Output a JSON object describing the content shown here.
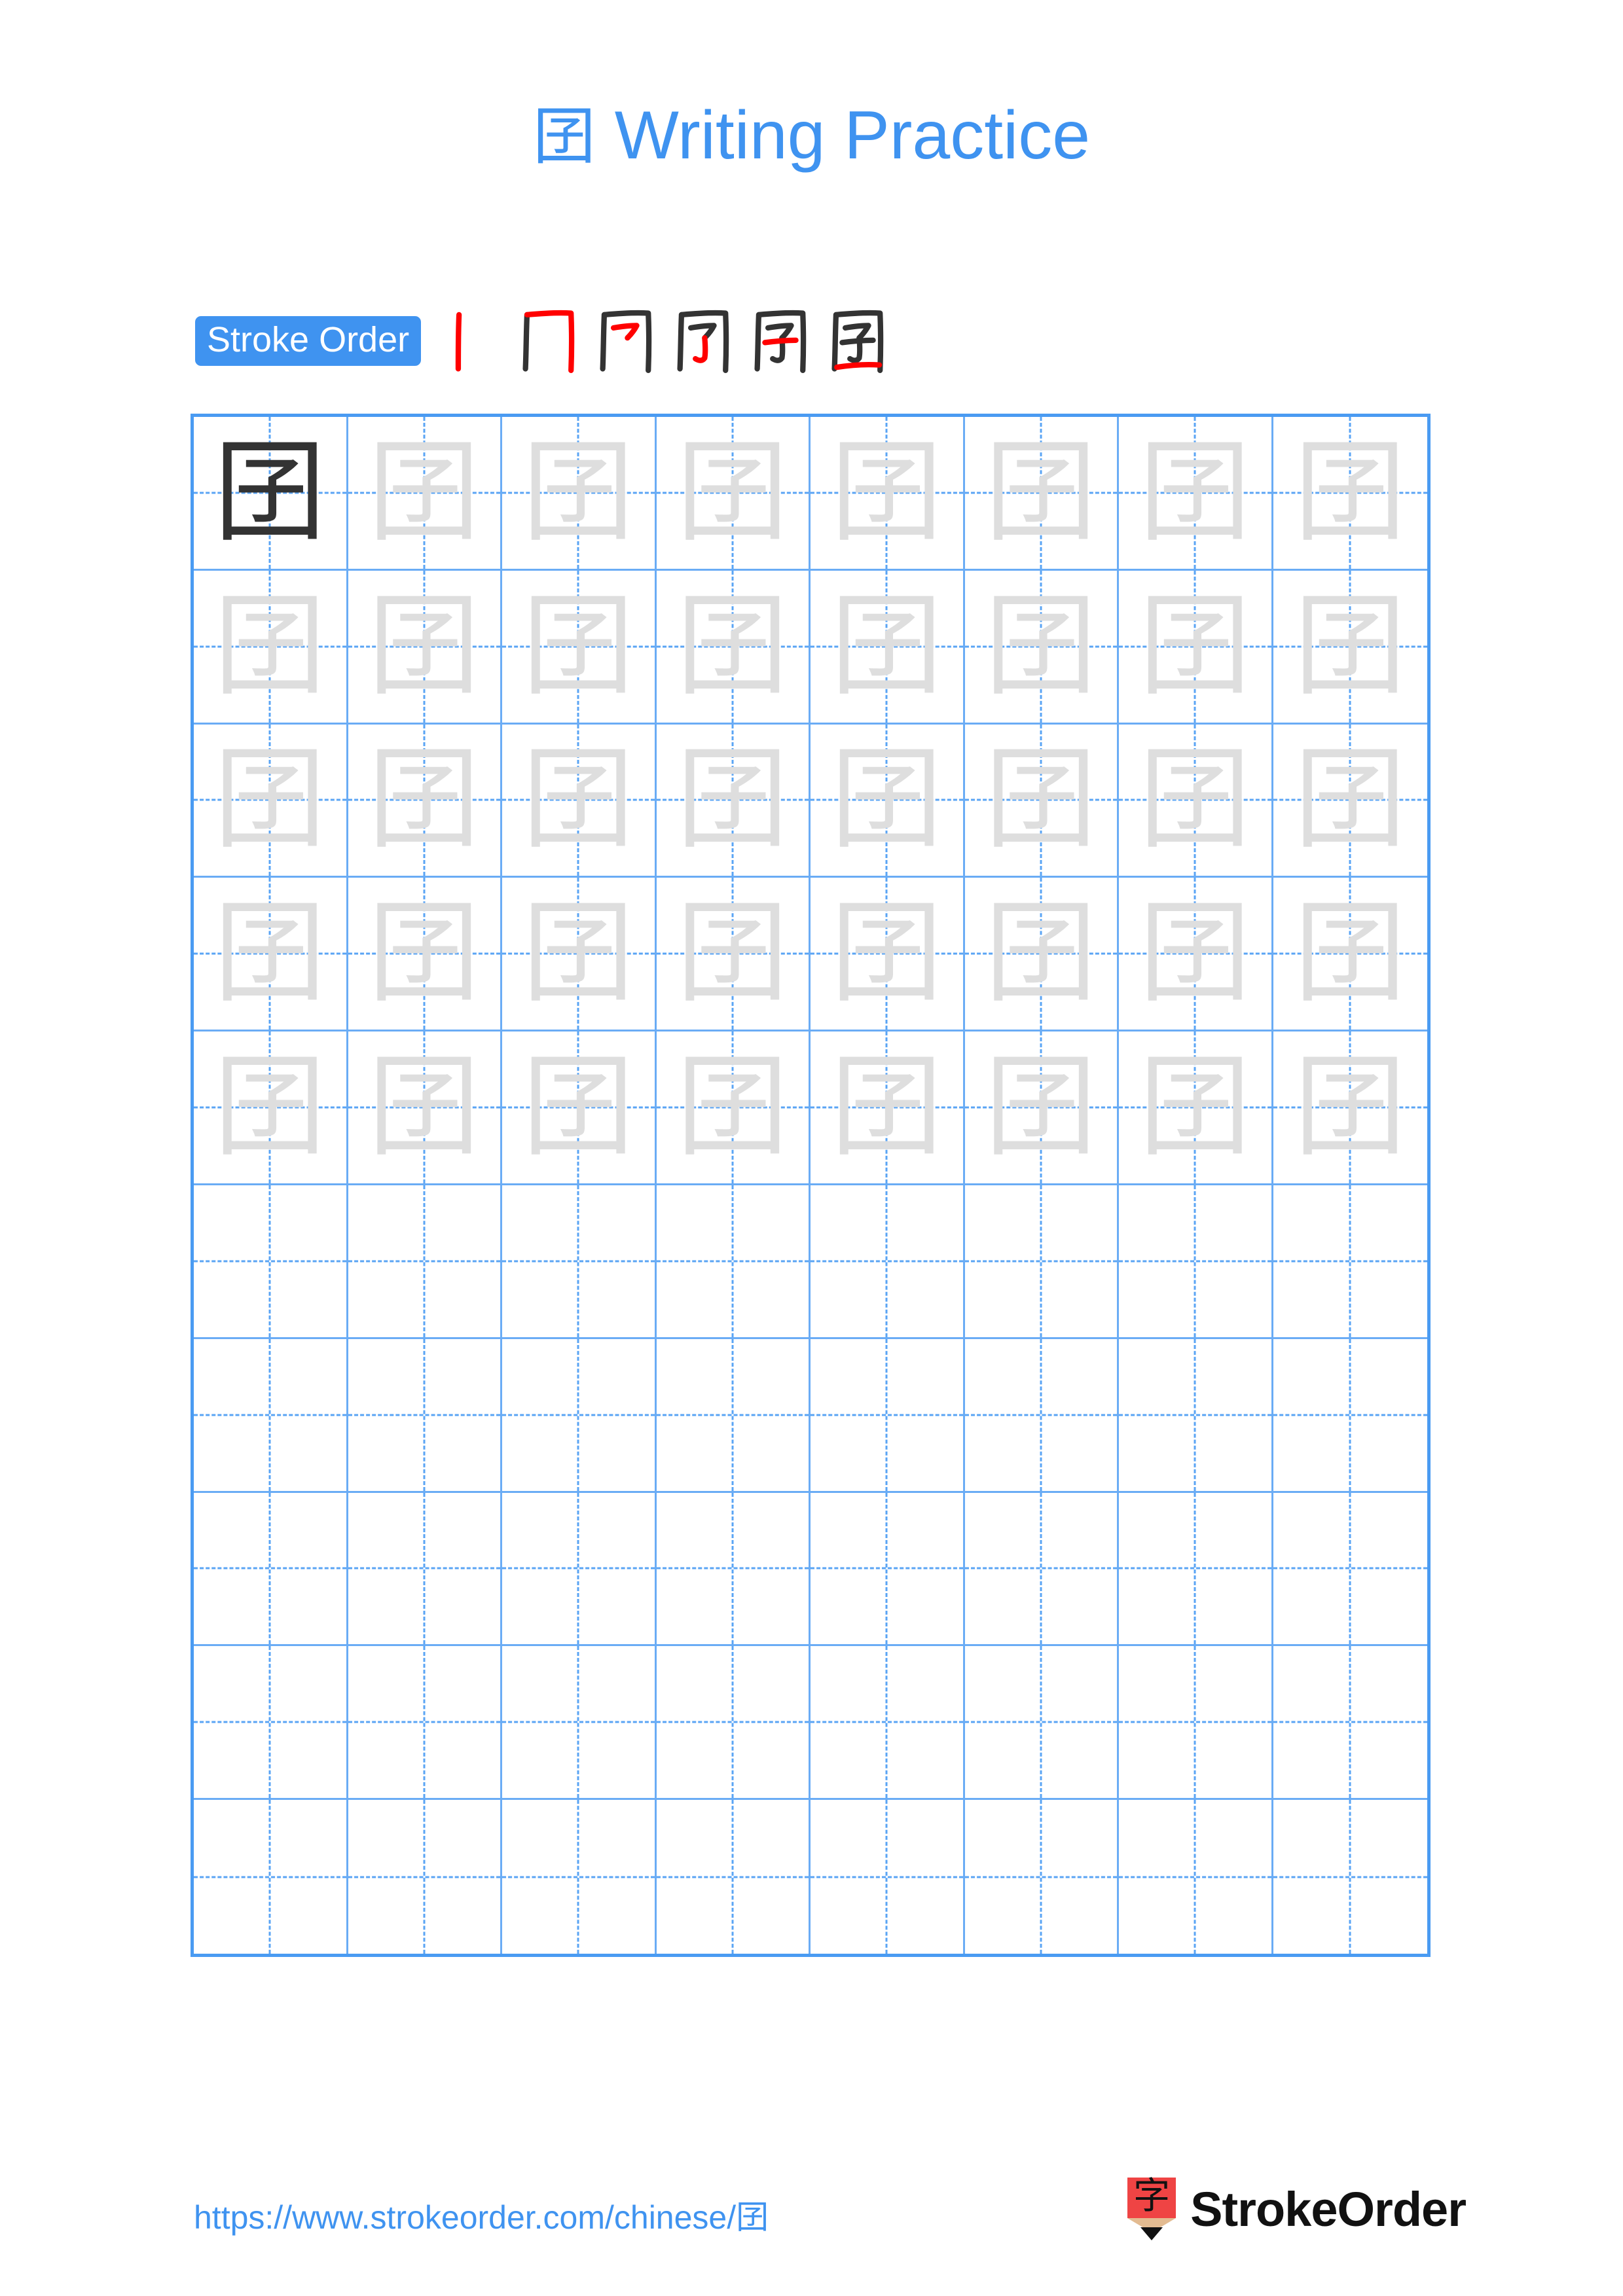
{
  "page": {
    "character": "囝",
    "title_suffix": " Writing Practice",
    "background_color": "#ffffff",
    "accent_color": "#3f93f0",
    "grid_line_color": "#4a9bf2",
    "grid_inner_line_color": "#6aacf5",
    "guide_dash_color": "#5aa4f4",
    "solid_char_color": "#333333",
    "trace_char_color": "#dedede",
    "stroke_highlight_color": "#ff0000",
    "stroke_ink_color": "#333333"
  },
  "stroke_order": {
    "badge_label": "Stroke Order",
    "total_strokes": 6,
    "steps": [
      {
        "index": 1,
        "partial": "丨",
        "new_stroke": "丨 vertical-left"
      },
      {
        "index": 2,
        "partial": "冂",
        "new_stroke": "horizontal + vertical-right hook"
      },
      {
        "index": 3,
        "partial": "冋",
        "new_stroke": "㇇ horizontal-turn (inner 子 top)"
      },
      {
        "index": 4,
        "partial": "冐",
        "new_stroke": "亅 vertical hook (inner 子 stem)"
      },
      {
        "index": 5,
        "partial": "囷",
        "new_stroke": "一 horizontal (inner 子 cross)"
      },
      {
        "index": 6,
        "partial": "囝",
        "new_stroke": "一 bottom closing horizontal"
      }
    ]
  },
  "grid": {
    "columns": 8,
    "rows": 10,
    "filled_rows": 5,
    "empty_rows": 5,
    "first_cell_style": "solid",
    "other_filled_cell_style": "trace",
    "cells": [
      [
        "solid",
        "trace",
        "trace",
        "trace",
        "trace",
        "trace",
        "trace",
        "trace"
      ],
      [
        "trace",
        "trace",
        "trace",
        "trace",
        "trace",
        "trace",
        "trace",
        "trace"
      ],
      [
        "trace",
        "trace",
        "trace",
        "trace",
        "trace",
        "trace",
        "trace",
        "trace"
      ],
      [
        "trace",
        "trace",
        "trace",
        "trace",
        "trace",
        "trace",
        "trace",
        "trace"
      ],
      [
        "trace",
        "trace",
        "trace",
        "trace",
        "trace",
        "trace",
        "trace",
        "trace"
      ],
      [
        "blank",
        "blank",
        "blank",
        "blank",
        "blank",
        "blank",
        "blank",
        "blank"
      ],
      [
        "blank",
        "blank",
        "blank",
        "blank",
        "blank",
        "blank",
        "blank",
        "blank"
      ],
      [
        "blank",
        "blank",
        "blank",
        "blank",
        "blank",
        "blank",
        "blank",
        "blank"
      ],
      [
        "blank",
        "blank",
        "blank",
        "blank",
        "blank",
        "blank",
        "blank",
        "blank"
      ],
      [
        "blank",
        "blank",
        "blank",
        "blank",
        "blank",
        "blank",
        "blank",
        "blank"
      ]
    ]
  },
  "footer": {
    "url": "https://www.strokeorder.com/chinese/囝",
    "logo_text": "StrokeOrder",
    "logo_glyph": "字"
  }
}
